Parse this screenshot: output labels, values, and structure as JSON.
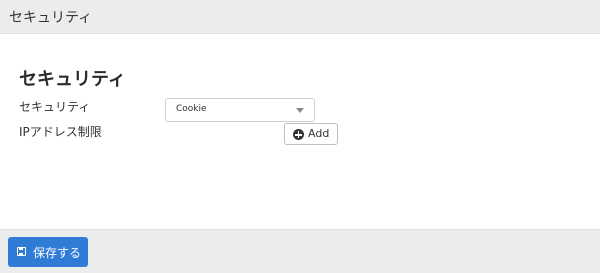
{
  "header": {
    "title": "セキュリティ"
  },
  "section": {
    "title": "セキュリティ"
  },
  "form": {
    "security_label": "セキュリティ",
    "security_select": {
      "selected": "Cookie"
    },
    "ip_restriction_label": "IPアドレス制限",
    "add_button_label": "Add",
    "add_icon": "plus-circle-icon"
  },
  "footer": {
    "save_button_label": "保存する",
    "save_icon": "floppy-disk-icon"
  },
  "colors": {
    "header_bg": "#ececec",
    "footer_bg": "#ececec",
    "primary_button": "#2f7bd6"
  }
}
